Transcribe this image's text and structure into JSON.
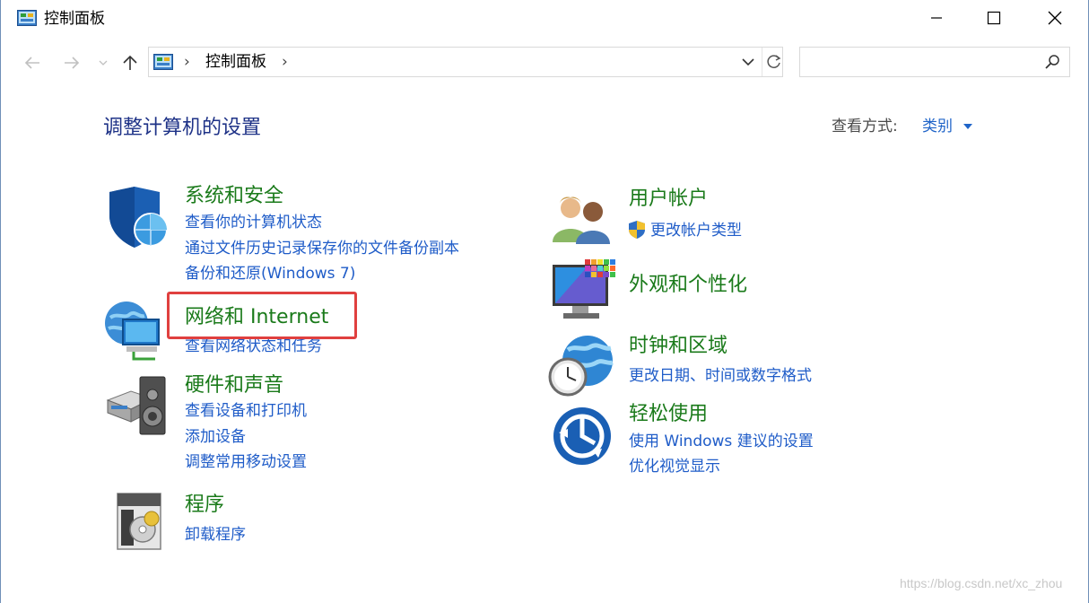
{
  "window": {
    "title": "控制面板"
  },
  "address": {
    "path_item": "控制面板",
    "separator": "›"
  },
  "search": {
    "placeholder": ""
  },
  "content": {
    "heading": "调整计算机的设置",
    "view_by_label": "查看方式:",
    "view_by_value": "类别"
  },
  "categories": [
    {
      "title": "系统和安全",
      "icon": "shield-globe-icon",
      "links": [
        "查看你的计算机状态",
        "通过文件历史记录保存你的文件备份副本",
        "备份和还原(Windows 7)"
      ]
    },
    {
      "title": "网络和 Internet",
      "icon": "network-globe-icon",
      "links": [
        "查看网络状态和任务"
      ]
    },
    {
      "title": "硬件和声音",
      "icon": "printer-speaker-icon",
      "links": [
        "查看设备和打印机",
        "添加设备",
        "调整常用移动设置"
      ]
    },
    {
      "title": "程序",
      "icon": "program-disc-icon",
      "links": [
        "卸载程序"
      ]
    },
    {
      "title": "用户帐户",
      "icon": "users-icon",
      "links": [
        "更改帐户类型"
      ]
    },
    {
      "title": "外观和个性化",
      "icon": "monitor-palette-icon",
      "links": []
    },
    {
      "title": "时钟和区域",
      "icon": "clock-globe-icon",
      "links": [
        "更改日期、时间或数字格式"
      ]
    },
    {
      "title": "轻松使用",
      "icon": "ease-of-access-icon",
      "links": [
        "使用 Windows 建议的设置",
        "优化视觉显示"
      ]
    }
  ],
  "watermark": "https://blog.csdn.net/xc_zhou",
  "colors": {
    "category_title": "#1a7a1a",
    "link": "#1f5cc8",
    "heading": "#1e3287",
    "highlight": "#e0403f"
  }
}
